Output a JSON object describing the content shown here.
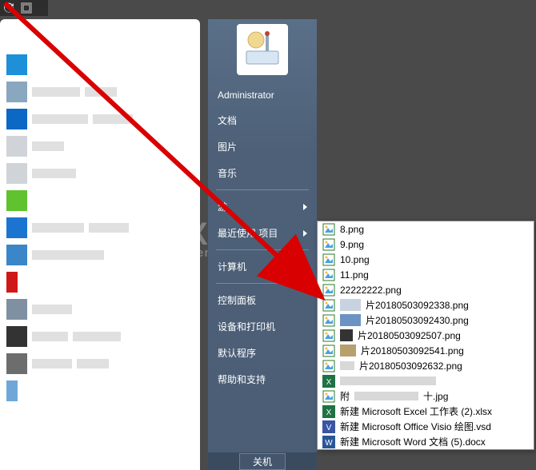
{
  "toolbar": {
    "icon1_name": "rotate-icon",
    "icon2_name": "fullscreen-icon"
  },
  "watermark": {
    "big": "GXJ 网",
    "small": "system.com"
  },
  "left_programs": [
    {
      "color": "#ffffff",
      "labelW": 0
    },
    {
      "color": "#1e90d8",
      "labelW": 0
    },
    {
      "color": "#8aa7c0",
      "labelW": 60,
      "label2W": 40
    },
    {
      "color": "#0b68c4",
      "labelW": 70,
      "label2W": 50
    },
    {
      "color": "#d0d4d8",
      "labelW": 40
    },
    {
      "color": "#d0d4d8",
      "labelW": 55
    },
    {
      "color": "#5fc22e",
      "labelW": 0
    },
    {
      "color": "#1b75d0",
      "labelW": 65,
      "label2W": 50
    },
    {
      "color": "#3a86c8",
      "labelW": 90
    },
    {
      "color": "#d01818",
      "labelW": 0,
      "half": true
    },
    {
      "color": "#7f90a2",
      "labelW": 50
    },
    {
      "color": "#333333",
      "labelW": 45,
      "label2W": 60
    },
    {
      "color": "#6d6d6d",
      "labelW": 50,
      "label2W": 40
    },
    {
      "color": "#6fa8d8",
      "labelW": 0,
      "half": true
    }
  ],
  "sidebar": {
    "user": "Administrator",
    "items": [
      {
        "label": "文档",
        "arrow": false
      },
      {
        "label": "图片",
        "arrow": false
      },
      {
        "label": "音乐",
        "arrow": false
      },
      {
        "label": "游",
        "arrow": true,
        "sep_before": true
      },
      {
        "label": "最近使用",
        "arrow": true,
        "extra": "项目"
      },
      {
        "label": "计算机",
        "arrow": false,
        "sep_before": true
      },
      {
        "label": "控制面板",
        "arrow": false,
        "sep_before": true
      },
      {
        "label": "设备和打印机",
        "arrow": false
      },
      {
        "label": "默认程序",
        "arrow": false
      },
      {
        "label": "帮助和支持",
        "arrow": false
      }
    ],
    "shutdown": "关机"
  },
  "flyout": {
    "items": [
      {
        "type": "img",
        "label": "8.png"
      },
      {
        "type": "img",
        "label": "9.png"
      },
      {
        "type": "img",
        "label": "10.png"
      },
      {
        "type": "img",
        "label": "11.png"
      },
      {
        "type": "img",
        "label": "22222222.png"
      },
      {
        "type": "img-thumb",
        "thumb": "t1",
        "suffix": "片20180503092338.png"
      },
      {
        "type": "img-thumb",
        "thumb": "t2",
        "suffix": "片20180503092430.png"
      },
      {
        "type": "img-thumb",
        "thumb": "t3",
        "suffix": "片20180503092507.png"
      },
      {
        "type": "img-thumb",
        "thumb": "t4",
        "suffix": "片20180503092541.png"
      },
      {
        "type": "img",
        "label": "片20180503092632.png",
        "pixelated": true
      },
      {
        "type": "xlsx",
        "pixelated_full": true
      },
      {
        "type": "img",
        "label": "附",
        "pixelated_mid": true,
        "suffix2": "十.jpg"
      },
      {
        "type": "xlsx",
        "label": "新建 Microsoft Excel 工作表 (2).xlsx"
      },
      {
        "type": "vsd",
        "label": "新建 Microsoft Office Visio 绘图.vsd"
      },
      {
        "type": "docx",
        "label": "新建 Microsoft Word 文档 (5).docx"
      }
    ]
  }
}
